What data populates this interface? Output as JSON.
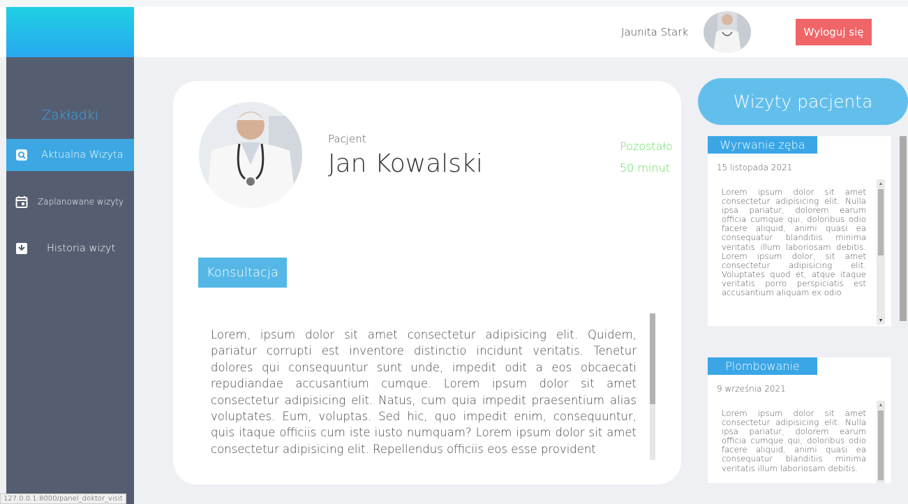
{
  "header": {
    "user_name": "Jaunita Stark",
    "logout_label": "Wyloguj się"
  },
  "sidebar": {
    "title": "Zakładki",
    "items": [
      {
        "label": "Aktualna Wizyta",
        "icon": "search-doc-icon",
        "active": true
      },
      {
        "label": "Zaplanowane wizyty",
        "icon": "calendar-icon",
        "active": false
      },
      {
        "label": "Historia wizyt",
        "icon": "archive-icon",
        "active": false
      }
    ]
  },
  "visit": {
    "patient_label": "Pacjent",
    "patient_name": "Jan Kowalski",
    "remaining_label": "Pozostało",
    "remaining_value": "50 minut",
    "type": "Konsultacja",
    "notes": "Lorem, ipsum dolor sit amet consectetur adipisicing elit. Quidem, pariatur corrupti est inventore distinctio incidunt veritatis. Tenetur dolores qui consequuntur sunt unde, impedit odit a eos obcaecati repudiandae accusantium cumque. Lorem ipsum dolor sit amet consectetur adipisicing elit. Natus, cum quia impedit praesentium alias voluptates. Eum, voluptas. Sed hic, quo impedit enim, consequuntur, quis itaque officiis cum iste iusto numquam? Lorem ipsum dolor sit amet consectetur adipisicing elit. Repellendus officiis eos esse provident"
  },
  "history": {
    "title": "Wizyty pacjenta",
    "cards": [
      {
        "title": "Wyrwanie zęba",
        "date": "15 listopada 2021",
        "body": "Lorem ipsum dolor sit amet consectetur adipisicing elit. Nulla ipsa pariatur, dolorem earum officia cumque qui, doloribus odio facere aliquid, animi quasi ea consequatur blanditiis minima veritatis illum laboriosam debitis. Lorem ipsum dolor, sit amet consectetur adipisicing elit. Voluptates quod et, atque itaque veritatis porro perspiciatis est accusantium aliquam ex odio"
      },
      {
        "title": "Plombowanie",
        "date": "9 września 2021",
        "body": "Lorem ipsum dolor sit amet consectetur adipisicing elit. Nulla ipsa pariatur, dolorem earum officia cumque qui, doloribus odio facere aliquid, animi quasi ea consequatur blanditiis minima veritatis illum laboriosam debitis."
      }
    ]
  },
  "status_bar": {
    "url": "127.0.0.1:8000/panel_doktor_visit"
  },
  "colors": {
    "accent": "#3ca7e3",
    "sidebar": "#555e70",
    "logout": "#f06567",
    "remaining": "#5cdc56"
  }
}
